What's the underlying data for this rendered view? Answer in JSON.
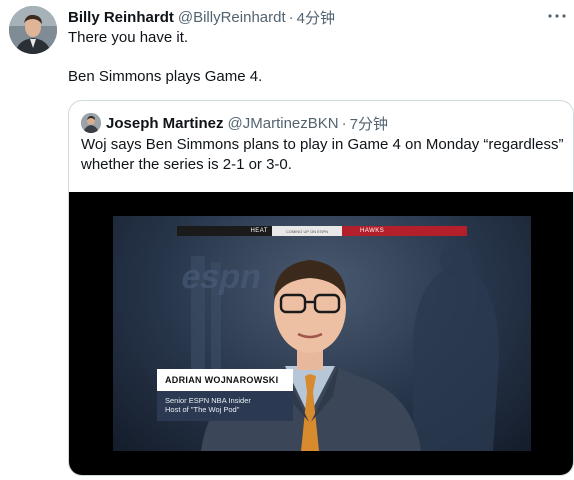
{
  "tweet": {
    "display_name": "Billy Reinhardt",
    "handle": "@BillyReinhardt",
    "separator": "·",
    "time": "4分钟",
    "lines": [
      "There you have it.",
      "Ben Simmons plays Game 4."
    ]
  },
  "quoted_tweet": {
    "display_name": "Joseph Martinez",
    "handle": "@JMartinezBKN",
    "separator": "·",
    "time": "7分钟",
    "text": "Woj says Ben Simmons plans to play in Game 4 on Monday “regardless” whether the series is 2-1 or 3-0."
  },
  "video": {
    "score_left": "HEAT",
    "score_mid": "COMING UP ON ESPN",
    "score_right": "HAWKS",
    "lower_third_name": "ADRIAN WOJNAROWSKI",
    "lower_third_title_1": "Senior ESPN NBA Insider",
    "lower_third_title_2": "Host of \"The Woj Pod\""
  },
  "icons": {
    "more": "more-horizontal-icon",
    "espn_logo": "espn-logo"
  },
  "colors": {
    "text_primary": "#0f1419",
    "text_secondary": "#536471",
    "border": "#cfd9de",
    "hawks_red": "#b3202b",
    "lower_third_bg": "#2b3a52"
  }
}
